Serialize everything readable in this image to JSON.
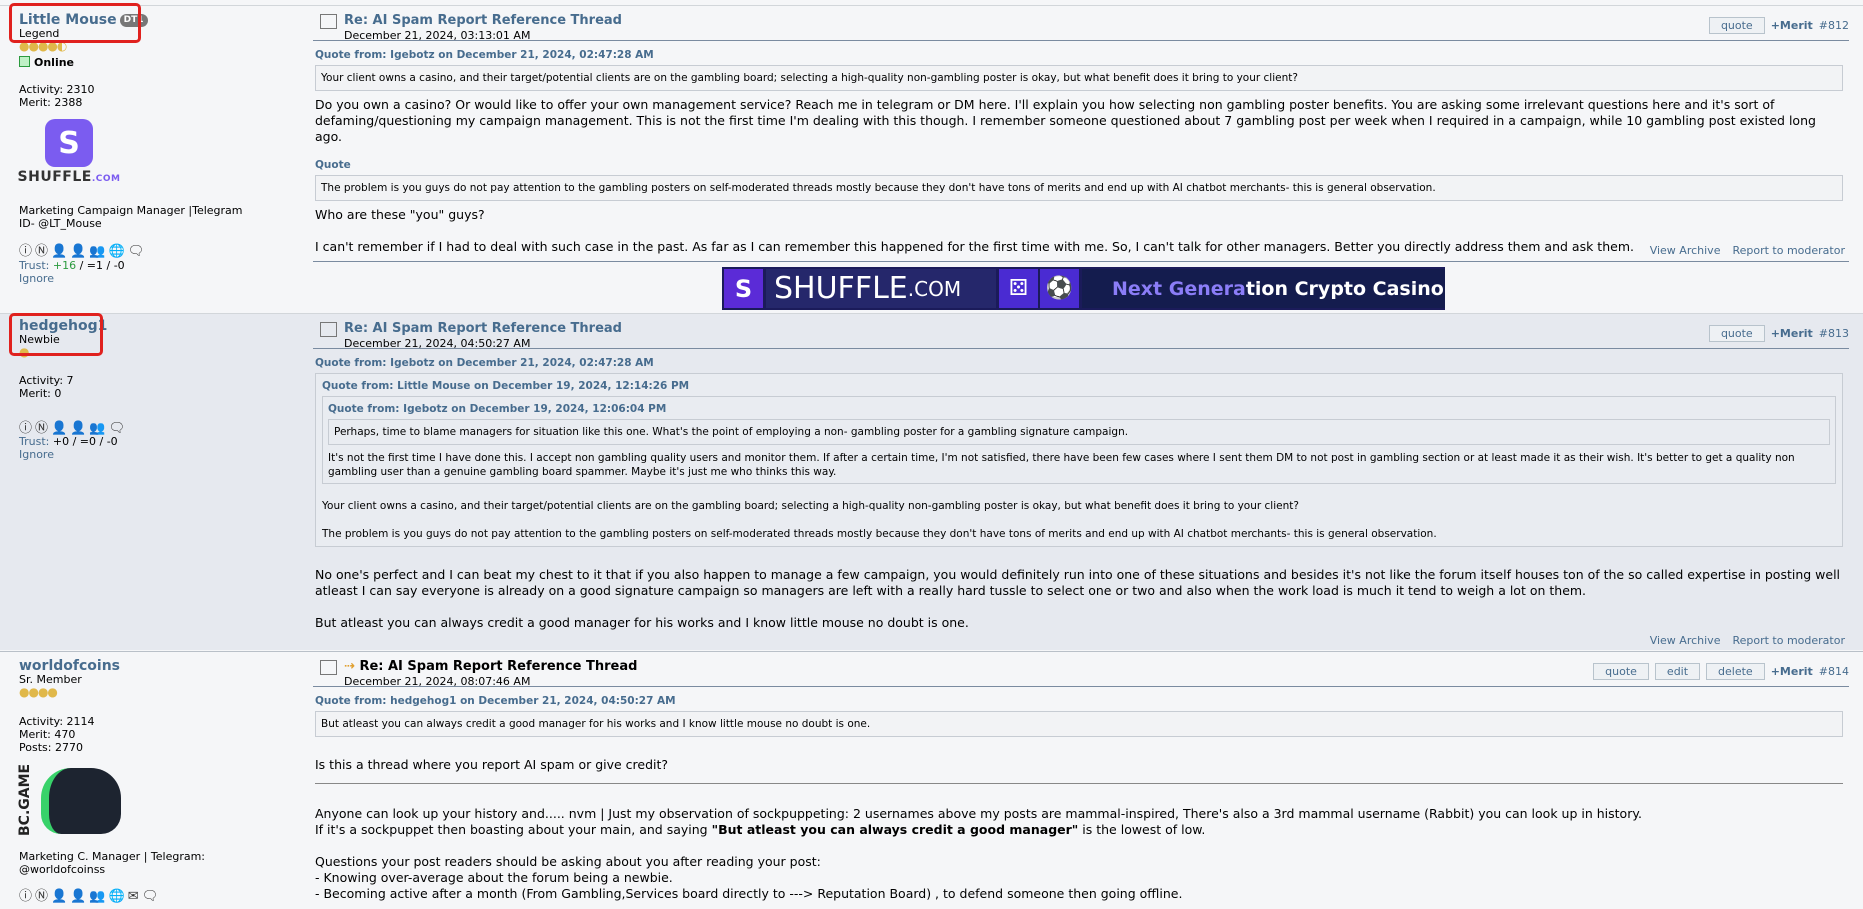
{
  "posts": [
    {
      "username": "Little Mouse",
      "badge": "DT1",
      "rank": "Legend",
      "coins": "●●●●◐",
      "online": "Online",
      "activity": "Activity: 2310",
      "merit": "Merit: 2388",
      "avatar_brand": "SHUFFLE",
      "avatar_suffix": ".COM",
      "personal_text": "Marketing Campaign Manager |Telegram ID- @LT_Mouse",
      "trust_label": "Trust:",
      "trust_pos": "+16",
      "trust_rest": "/ =1 / -0",
      "ignore": "Ignore",
      "title": "Re: AI Spam Report Reference Thread",
      "date": "December 21, 2024, 03:13:01 AM",
      "quote_btn": "quote",
      "merit_link": "+Merit",
      "num": "#812",
      "quote1_head": "Quote from: Igebotz on December 21, 2024, 02:47:28 AM",
      "quote1_body": "Your client owns a casino, and their target/potential clients are on the gambling board; selecting a high-quality non-gambling poster is okay, but what benefit does it bring to your client?",
      "p1": "Do you own a casino? Or would like to offer your own management service? Reach me in telegram or DM here. I'll explain you how selecting non gambling poster benefits. You are asking some irrelevant questions here and it's sort of defaming/questioning my campaign management. This is not the first time I'm dealing with this though. I remember someone questioned about 7 gambling post per week when I required in a campaign, while 10 gambling post existed long ago.",
      "quote2_head": "Quote",
      "quote2_body": "The problem is you guys do not pay attention to the gambling posters on self-moderated threads mostly because they don't have tons of merits and end up with AI chatbot merchants- this is general observation.",
      "p2": "Who are these \"you\" guys?",
      "p3": "I can't remember if I had to deal with such case in the past. As far as I can remember this happened for the first time with me. So, I can't talk for other managers. Better you directly address them and ask them.",
      "view_archive": "View Archive",
      "report": "Report to moderator"
    },
    {
      "username": "hedgehog1",
      "rank": "Newbie",
      "coins": "●",
      "activity": "Activity: 7",
      "merit": "Merit: 0",
      "trust_label": "Trust:",
      "trust_rest": "+0 / =0 / -0",
      "ignore": "Ignore",
      "title": "Re: AI Spam Report Reference Thread",
      "date": "December 21, 2024, 04:50:27 AM",
      "quote_btn": "quote",
      "merit_link": "+Merit",
      "num": "#813",
      "q_head": "Quote from: Igebotz on December 21, 2024, 02:47:28 AM",
      "q_inner_head": "Quote from: Little Mouse on December 19, 2024, 12:14:26 PM",
      "q_inner2_head": "Quote from: Igebotz on December 19, 2024, 12:06:04 PM",
      "q_inner2_body": "Perhaps, time to blame managers for situation like this one. What's the point of employing a non- gambling poster for a gambling signature campaign.",
      "q_inner_body": "It's not the first time I have done this. I accept non gambling quality users and monitor them. If after a certain time, I'm not satisfied, there have been few cases where I sent them DM to not post in gambling section or at least made it as their wish. It's better to get a quality non gambling user than a genuine gambling board spammer. Maybe it's just me who thinks this way.",
      "q_body1": "Your client owns a casino, and their target/potential clients are on the gambling board; selecting a high-quality non-gambling poster is okay, but what benefit does it bring to your client?",
      "q_body2": "The problem is you guys do not pay attention to the gambling posters on self-moderated threads mostly because they don't have tons of merits and end up with AI chatbot merchants- this is general observation.",
      "p1": "No one's perfect and I can beat my chest to it that if you also happen to manage a few campaign, you would definitely run into one of these situations and besides it's not like the forum itself houses ton of the so called expertise in posting well atleast I can say everyone is already on a good signature campaign so managers are left with a really hard tussle to select one or two and also when the work load is much it tend to weigh a lot on them.",
      "p2": "But atleast you can always credit a good manager for his works and I know little mouse no doubt is one.",
      "view_archive": "View Archive",
      "report": "Report to moderator"
    },
    {
      "username": "worldofcoins",
      "rank": "Sr. Member",
      "coins": "●●●●",
      "activity": "Activity: 2114",
      "merit": "Merit: 470",
      "posts": "Posts: 2770",
      "avatar_brand": "BC.GAME",
      "personal_text": "Marketing C. Manager | Telegram: @worldofcoinss",
      "arrow": "⇢",
      "title": "Re: AI Spam Report Reference Thread",
      "date": "December 21, 2024, 08:07:46 AM",
      "quote_btn": "quote",
      "edit_btn": "edit",
      "delete_btn": "delete",
      "merit_link": "+Merit",
      "num": "#814",
      "q_head": "Quote from: hedgehog1 on December 21, 2024, 04:50:27 AM",
      "q_body": "But atleast you can always credit a good manager for his works and I know little mouse no doubt is one.",
      "p1": "Is this a thread where you report AI spam or give credit?",
      "p2": "Anyone can look up your history and..... nvm | Just my observation of sockpuppeting: 2 usernames above my posts are mammal-inspired, There's also a 3rd mammal username (Rabbit) you can look up in history.",
      "p3a": "If it's a sockpuppet then boasting about your main, and saying ",
      "p3b": "\"But atleast you can always credit a good manager\"",
      "p3c": " is the lowest of low.",
      "p4": "Questions your post readers should be asking about you after reading your post:",
      "p5": "- Knowing over-average about the forum being a newbie.",
      "p6": "- Becoming active after a month (From Gambling,Services board directly to ---> Reputation Board) , to defend someone then going offline."
    }
  ],
  "banner": {
    "word": "SHUFFLE",
    "word_suffix": ".COM",
    "tagline_a": "Next Genera",
    "tagline_b": "tion Crypto Casino"
  },
  "colors": {
    "link": "#476c8e",
    "highlight": "#e0211e",
    "banner_bg": "#1b1b5a"
  }
}
